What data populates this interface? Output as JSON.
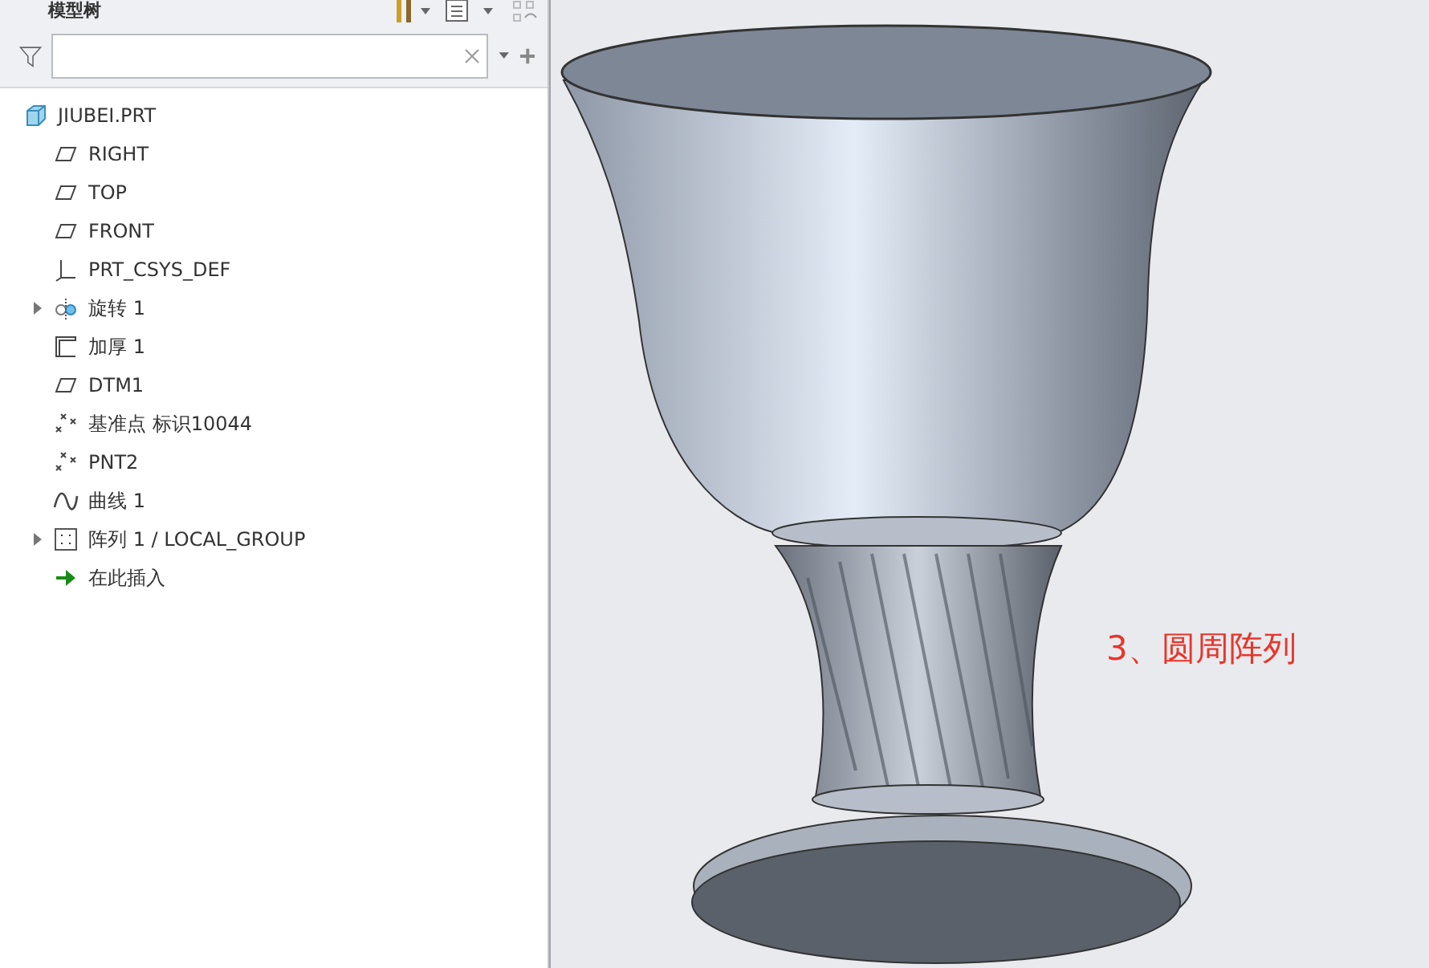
{
  "panel": {
    "title": "模型树"
  },
  "tree": {
    "label": "JIUBEI.PRT",
    "kind": "part",
    "children": [
      {
        "label": "RIGHT",
        "kind": "plane"
      },
      {
        "label": "TOP",
        "kind": "plane"
      },
      {
        "label": "FRONT",
        "kind": "plane"
      },
      {
        "label": "PRT_CSYS_DEF",
        "kind": "csys"
      },
      {
        "label": "旋转 1",
        "kind": "revolve",
        "expanded": false
      },
      {
        "label": "加厚 1",
        "kind": "thicken"
      },
      {
        "label": "DTM1",
        "kind": "plane"
      },
      {
        "label": "基准点 标识10044",
        "kind": "point"
      },
      {
        "label": "PNT2",
        "kind": "point"
      },
      {
        "label": "曲线 1",
        "kind": "curve"
      },
      {
        "label": "阵列 1 / LOCAL_GROUP",
        "kind": "pattern",
        "expanded": false
      },
      {
        "label": "在此插入",
        "kind": "insert"
      }
    ]
  },
  "viewport": {
    "annotation": "3、圆周阵列"
  }
}
